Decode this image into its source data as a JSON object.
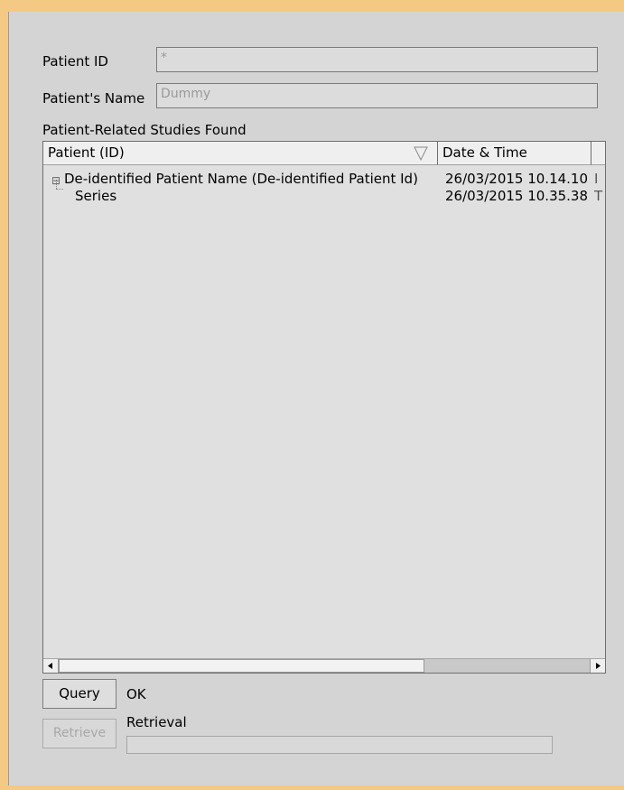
{
  "form": {
    "patient_id_label": "Patient ID",
    "patient_id_value": "*",
    "patient_name_label": "Patient's Name",
    "patient_name_value": "Dummy"
  },
  "results": {
    "section_label": "Patient-Related Studies Found",
    "columns": [
      "Patient (ID)",
      "Date & Time"
    ],
    "rows": [
      {
        "expander": "⊟",
        "patient": "De-identified Patient Name (De-identified Patient Id)",
        "datetime": "26/03/2015 10.14.10"
      },
      {
        "patient": "Series",
        "datetime": "26/03/2015 10.35.38"
      }
    ],
    "overflow_col_fragments": [
      "I",
      "T"
    ]
  },
  "actions": {
    "query_label": "Query",
    "query_status": "OK",
    "retrieve_label": "Retrieve",
    "retrieval_label": "Retrieval"
  }
}
